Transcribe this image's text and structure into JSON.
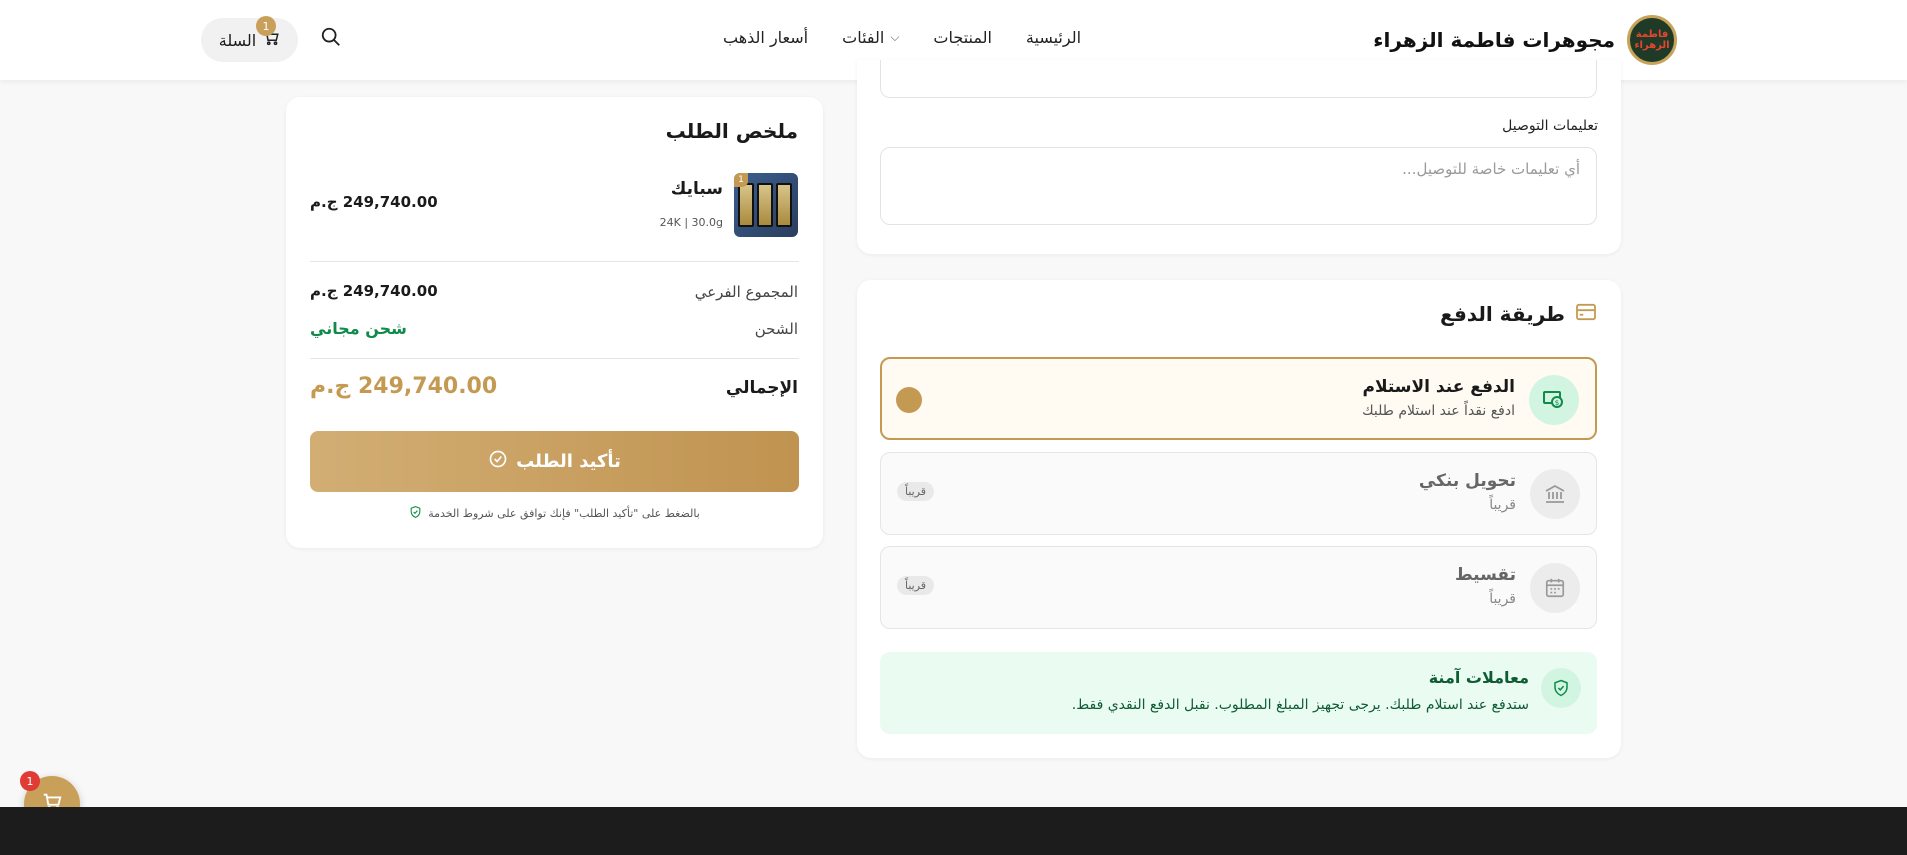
{
  "header": {
    "brand_name": "مجوهرات فاطمة الزهراء",
    "logo_text": "فاطمة الزهراء",
    "nav": {
      "home": "الرئيسية",
      "products": "المنتجات",
      "categories": "الفئات",
      "gold_prices": "أسعار الذهب"
    },
    "cart_label": "السلة",
    "cart_count": "1"
  },
  "delivery": {
    "instructions_label": "تعليمات التوصيل",
    "instructions_placeholder": "أي تعليمات خاصة للتوصيل..."
  },
  "payment": {
    "title": "طريقة الدفع",
    "options": [
      {
        "title": "الدفع عند الاستلام",
        "subtitle": "ادفع نقداً عند استلام طلبك",
        "selected": true
      },
      {
        "title": "تحويل بنكي",
        "subtitle": "قريباً",
        "badge": "قريباً",
        "selected": false
      },
      {
        "title": "تقسيط",
        "subtitle": "قريباً",
        "badge": "قريباً",
        "selected": false
      }
    ],
    "secure_title": "معاملات آمنة",
    "secure_text": "ستدفع عند استلام طلبك. يرجى تجهيز المبلغ المطلوب. نقبل الدفع النقدي فقط."
  },
  "summary": {
    "title": "ملخص الطلب",
    "item": {
      "name": "سبايك",
      "meta": "24K | 30.0g",
      "price": "249,740.00 ج.م",
      "quantity": "1"
    },
    "subtotal_label": "المجموع الفرعي",
    "subtotal_value": "249,740.00 ج.م",
    "shipping_label": "الشحن",
    "shipping_value": "شحن مجاني",
    "total_label": "الإجمالي",
    "total_value": "249,740.00 ج.م",
    "confirm_label": "تأكيد الطلب",
    "terms": "بالضغط على \"تأكيد الطلب\" فإنك توافق على شروط الخدمة"
  },
  "floating_cart": {
    "count": "1"
  },
  "colors": {
    "accent": "#c49a52",
    "success": "#0f8a4a",
    "secure_bg": "#eafbf2"
  }
}
